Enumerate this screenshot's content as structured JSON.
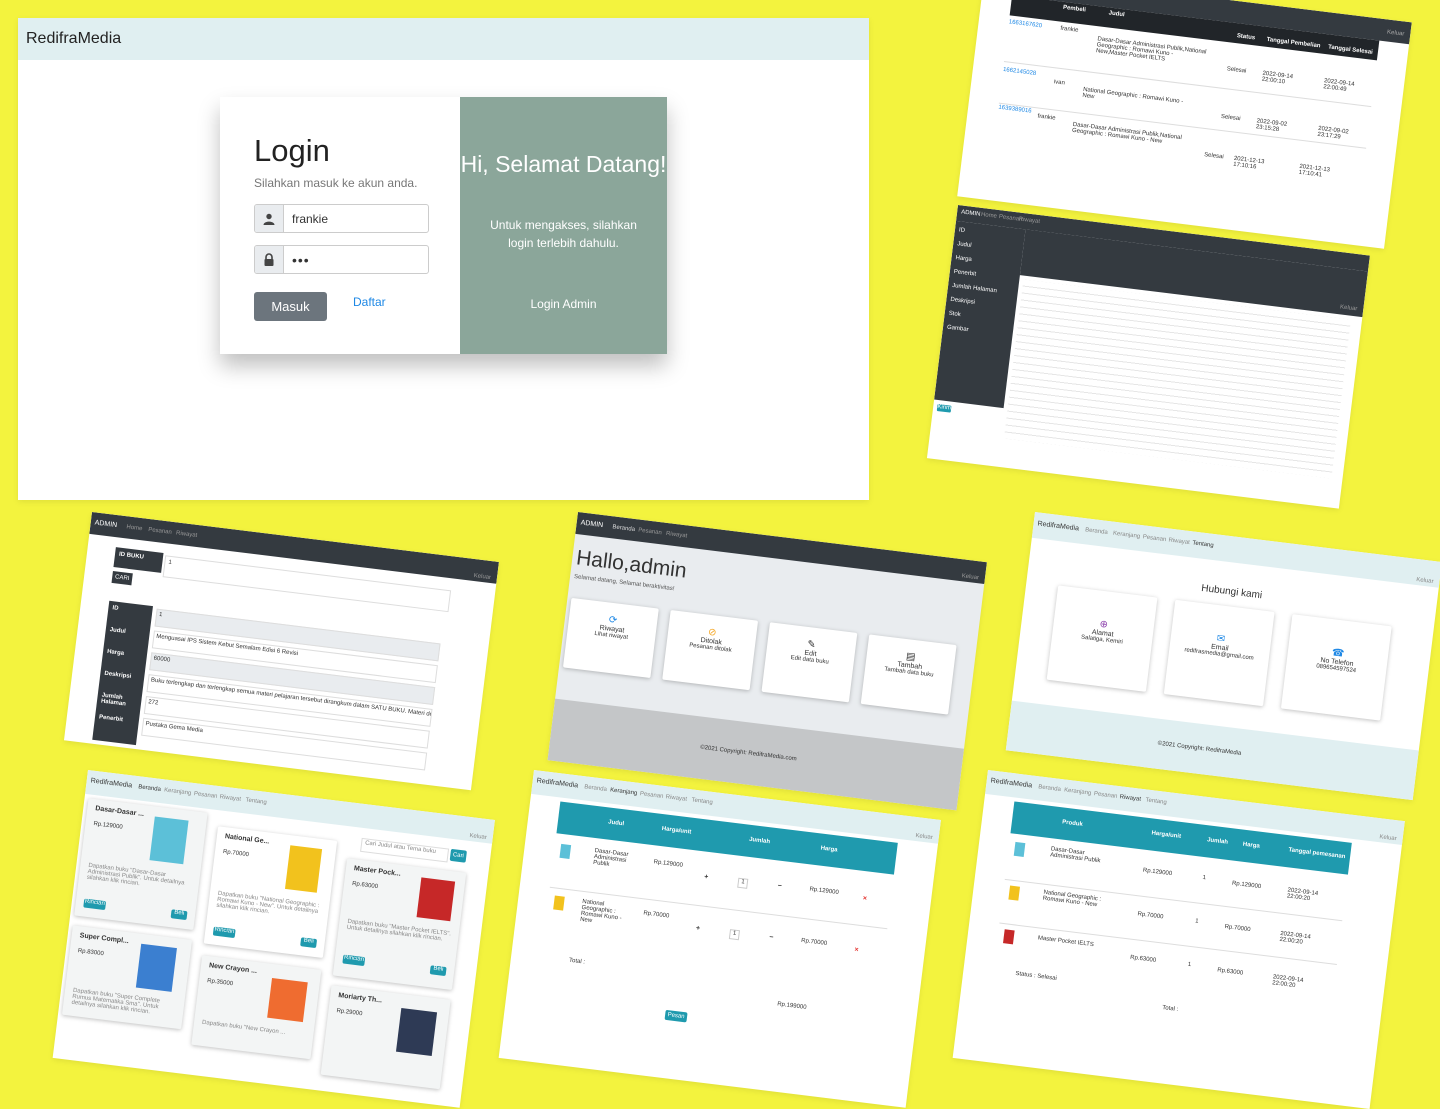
{
  "login_screen": {
    "brand": "RedifraMedia",
    "title": "Login",
    "subtitle": "Silahkan masuk ke akun anda.",
    "username_value": "frankie",
    "password_mask": "•••",
    "submit_label": "Masuk",
    "register_link": "Daftar",
    "welcome_title": "Hi, Selamat Datang!",
    "welcome_text": "Untuk mengakses, silahkan login terlebih dahulu.",
    "admin_link": "Login Admin",
    "icons": [
      "user-icon",
      "lock-icon"
    ]
  },
  "orders_table": {
    "headers": [
      "Pembeli",
      "Judul",
      "Status",
      "Tanggal Pembelian",
      "Tanggal Selesai"
    ],
    "nav_right": "Keluar",
    "rows": [
      {
        "id": "1663167620",
        "buyer": "frankie",
        "title": "Dasar-Dasar Administrasi Publik,National Geographic : Romawi Kuno - New,Master Pocket IELTS",
        "status": "Selesai",
        "date": "2022-09-14 22:00:10",
        "done": "2022-09-14 22:00:49"
      },
      {
        "id": "1662145028",
        "buyer": "ivan",
        "title": "National Geographic : Romawi Kuno - New",
        "status": "Selesai",
        "date": "2022-09-02 23:15:28",
        "done": "2022-09-02 23:17:29"
      },
      {
        "id": "1639389016",
        "buyer": "frankie",
        "title": "Dasar-Dasar Administrasi Publik,National Geographic : Romawi Kuno - New",
        "status": "Selesai",
        "date": "2021-12-13 17:10:16",
        "done": "2021-12-13 17:10:41"
      }
    ]
  },
  "admin_form": {
    "brand": "ADMIN",
    "nav_links": [
      "Home",
      "Pesanan",
      "Riwayat"
    ],
    "nav_right": "Keluar",
    "sidebar": [
      "ID",
      "Judul",
      "Harga",
      "Penerbit",
      "Jumlah Halaman",
      "Deskripsi",
      "Stok",
      "Gambar"
    ],
    "button": "Kirim"
  },
  "edit_book": {
    "brand": "ADMIN",
    "nav_links": [
      "Home",
      "Pesanan",
      "Riwayat"
    ],
    "nav_right": "Keluar",
    "id_label": "ID BUKU",
    "id_value": "1",
    "search_button": "CARI",
    "fields": [
      {
        "label": "ID",
        "value": "1"
      },
      {
        "label": "Judul",
        "value": "Menguasai IPS Sistem Kebut Semalam Edisi 6 Revisi"
      },
      {
        "label": "Harga",
        "value": "60000"
      },
      {
        "label": "Deskripsi",
        "value": "Buku terlengkap dan terlengkap semua materi pelajaran tersebut dirangkum dalam SATU BUKU. Materi de"
      },
      {
        "label": "Jumlah Halaman",
        "value": "272"
      },
      {
        "label": "Penerbit",
        "value": "Pustaka Gema Media"
      }
    ]
  },
  "admin_home": {
    "brand": "ADMIN",
    "nav_links": [
      "Beranda",
      "Pesanan",
      "Riwayat"
    ],
    "nav_right": "Keluar",
    "greeting": "Hallo,admin",
    "greeting_sub": "Selamat datang, Selamat beraktivitas!",
    "cards": [
      {
        "title": "Riwayat",
        "sub": "Lihat riwayat",
        "icon": "history-icon"
      },
      {
        "title": "Ditolak",
        "sub": "Pesanan ditolak",
        "icon": "rejected-icon"
      },
      {
        "title": "Edit",
        "sub": "Edit data buku",
        "icon": "edit-icon"
      },
      {
        "title": "Tambah",
        "sub": "Tambah data buku",
        "icon": "add-book-icon"
      }
    ],
    "footer": "©2021 Copyright: RedifraMedia.com"
  },
  "contact": {
    "brand": "RedifraMedia",
    "nav_links": [
      "Beranda",
      "Keranjang",
      "Pesanan",
      "Riwayat",
      "Tentang"
    ],
    "nav_right": "Keluar",
    "title": "Hubungi kami",
    "cards": [
      {
        "title": "Alamat",
        "sub": "Salatiga, Kemiri",
        "icon": "location-icon"
      },
      {
        "title": "Email",
        "sub": "redifrasmedia@gmail.com",
        "icon": "mail-icon"
      },
      {
        "title": "No Telefon",
        "sub": "089654597524",
        "icon": "phone-icon"
      }
    ],
    "footer": "©2021 Copyright: RedifraMedia"
  },
  "catalog": {
    "brand": "RedifraMedia",
    "nav_links": [
      "Beranda",
      "Keranjang",
      "Pesanan",
      "Riwayat",
      "Tentang"
    ],
    "nav_right": "Keluar",
    "search_placeholder": "Cari Judul atau Tema buku",
    "search_button": "Cari",
    "products": [
      {
        "title": "Dasar-Dasar ...",
        "price": "Rp.129000",
        "desc": "Dapatkan buku \"Dasar-Dasar Administrasi Publik\". Untuk detailnya silahkan klik rincian.",
        "cover": "#5cc0d8"
      },
      {
        "title": "National Ge...",
        "price": "Rp.70000",
        "desc": "Dapatkan buku \"National Geographic : Romawi Kuno - New\". Untuk detailnya silahkan klik rincian.",
        "cover": "#f2c21d"
      },
      {
        "title": "Master Pock...",
        "price": "Rp.63000",
        "desc": "Dapatkan buku \"Master Pocket IELTS\". Untuk detailnya silahkan klik rincian.",
        "cover": "#c62828"
      },
      {
        "title": "Super Compl...",
        "price": "Rp.83000",
        "desc": "Dapatkan buku \"Super Complete Rumus Matematika Sma\". Untuk detailnya silahkan klik rincian.",
        "cover": "#3b7fd0"
      },
      {
        "title": "New Crayon ...",
        "price": "Rp.35000",
        "desc": "Dapatkan buku \"New Crayon ...",
        "cover": "#ef6c30"
      },
      {
        "title": "Moriarty Th...",
        "price": "Rp.29000",
        "desc": "",
        "cover": "#2e3a55"
      }
    ],
    "detail_button": "Rincian",
    "buy_button": "Beli"
  },
  "cart": {
    "brand": "RedifraMedia",
    "nav_links": [
      "Beranda",
      "Keranjang",
      "Pesanan",
      "Riwayat",
      "Tentang"
    ],
    "nav_right": "Keluar",
    "headers": [
      "Judul",
      "Harga/unit",
      "Jumlah",
      "Harga"
    ],
    "rows": [
      {
        "title": "Dasar-Dasar Administrasi Publik",
        "unit": "Rp.129000",
        "qty": "1",
        "total": "Rp.129000"
      },
      {
        "title": "National Geographic : Romawi Kuno - New",
        "unit": "Rp.70000",
        "qty": "1",
        "total": "Rp.70000"
      }
    ],
    "plus": "+",
    "minus": "−",
    "remove": "×",
    "total_label": "Total :",
    "total_value": "Rp.199000",
    "order_button": "Pesan"
  },
  "history": {
    "brand": "RedifraMedia",
    "nav_links": [
      "Beranda",
      "Keranjang",
      "Pesanan",
      "Riwayat",
      "Tentang"
    ],
    "nav_right": "Keluar",
    "headers": [
      "Produk",
      "Harga/unit",
      "Jumlah",
      "Harga",
      "Tanggal pemesanan"
    ],
    "rows": [
      {
        "title": "Dasar-Dasar Administrasi Publik",
        "unit": "Rp.129000",
        "qty": "1",
        "total": "Rp.129000",
        "date": "2022-09-14 22:00:20"
      },
      {
        "title": "National Geographic : Romawi Kuno - New",
        "unit": "Rp.70000",
        "qty": "1",
        "total": "Rp.70000",
        "date": "2022-09-14 22:00:20"
      },
      {
        "title": "Master Pocket IELTS",
        "unit": "Rp.63000",
        "qty": "1",
        "total": "Rp.63000",
        "date": "2022-09-14 22:00:20"
      }
    ],
    "status": "Status : Selesai",
    "total_label": "Total :"
  }
}
